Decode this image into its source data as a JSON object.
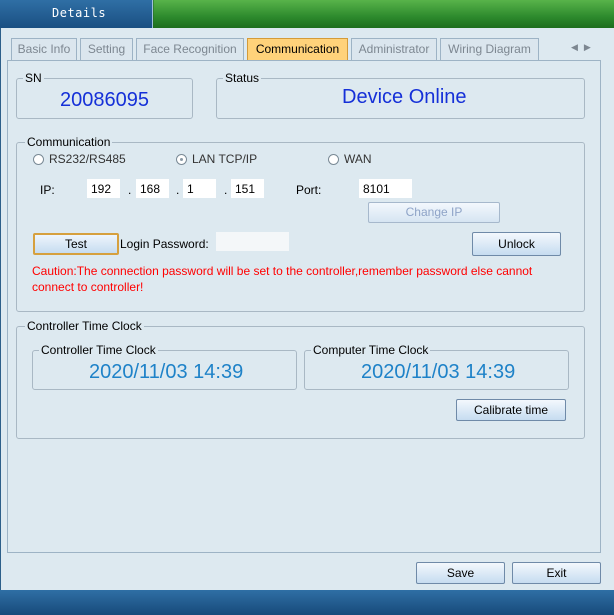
{
  "window": {
    "title": "Details"
  },
  "tabs": [
    {
      "label": "Basic Info",
      "active": false
    },
    {
      "label": "Setting",
      "active": false
    },
    {
      "label": "Face Recognition",
      "active": false
    },
    {
      "label": "Communication",
      "active": true
    },
    {
      "label": "Administrator",
      "active": false
    },
    {
      "label": "Wiring Diagram",
      "active": false
    }
  ],
  "sn": {
    "legend": "SN",
    "value": "20086095"
  },
  "status": {
    "legend": "Status",
    "value": "Device Online"
  },
  "communication": {
    "legend": "Communication",
    "modes": [
      {
        "label": "RS232/RS485",
        "selected": false
      },
      {
        "label": "LAN TCP/IP",
        "selected": true
      },
      {
        "label": "WAN",
        "selected": false
      }
    ],
    "ip_label": "IP:",
    "ip": [
      "192",
      "168",
      "1",
      "151"
    ],
    "ip_sep": ".",
    "port_label": "Port:",
    "port": "8101",
    "change_ip_label": "Change IP",
    "test_label": "Test",
    "login_password_label": "Login Password:",
    "login_password_value": "",
    "unlock_label": "Unlock",
    "caution": "Caution:The connection password will be set to the controller,remember password else cannot connect to controller!"
  },
  "clock": {
    "legend": "Controller Time Clock",
    "controller": {
      "legend": "Controller Time Clock",
      "value": "2020/11/03 14:39"
    },
    "computer": {
      "legend": "Computer Time Clock",
      "value": "2020/11/03 14:39"
    },
    "calibrate_label": "Calibrate time"
  },
  "footer": {
    "save_label": "Save",
    "exit_label": "Exit"
  },
  "tab_nav": {
    "prev_icon": "chevron-left-icon",
    "next_icon": "chevron-right-icon"
  },
  "colors": {
    "accent_blue": "#1530d8",
    "clock_blue": "#1e82c8",
    "caution_red": "#ff0000",
    "active_tab": "#ffd27a"
  }
}
